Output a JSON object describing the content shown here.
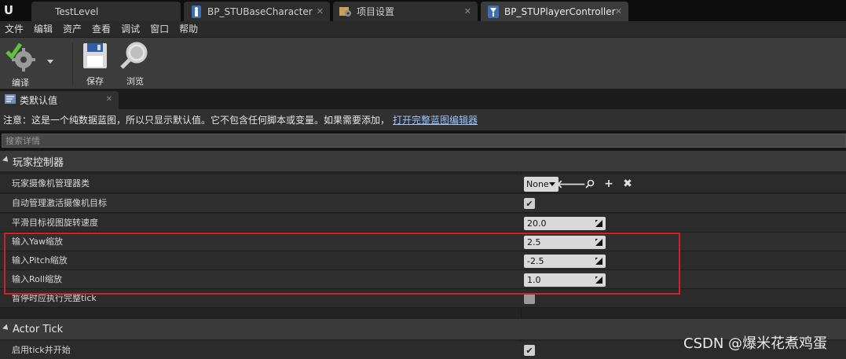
{
  "tabs": [
    {
      "label": "TestLevel",
      "icon": "level-icon"
    },
    {
      "label": "BP_STUBaseCharacter",
      "icon": "character-blueprint-icon"
    },
    {
      "label": "项目设置",
      "icon": "settings-icon"
    },
    {
      "label": "BP_STUPlayerController",
      "icon": "controller-blueprint-icon"
    }
  ],
  "menu": [
    "文件",
    "编辑",
    "资产",
    "查看",
    "调试",
    "窗口",
    "帮助"
  ],
  "toolbar": {
    "compile_label": "编译",
    "save_label": "保存",
    "browse_label": "浏览"
  },
  "panel": {
    "tab_label": "类默认值"
  },
  "notice": {
    "text": "注意：这是一个纯数据蓝图，所以只显示默认值。它不包含任何脚本或变量。如果需要添加，",
    "link": "打开完整蓝图编辑器"
  },
  "search": {
    "placeholder": "搜索详情"
  },
  "categories": {
    "player_controller": "玩家控制器",
    "actor_tick": "Actor Tick"
  },
  "properties": {
    "camera_manager_class": {
      "label": "玩家摄像机管理器类",
      "value": "None"
    },
    "auto_manage_camera": {
      "label": "自动管理激活摄像机目标",
      "checked": true
    },
    "smooth_rotation": {
      "label": "平滑目标视图旋转速度",
      "value": "20.0"
    },
    "input_yaw": {
      "label": "输入Yaw缩放",
      "value": "2.5"
    },
    "input_pitch": {
      "label": "输入Pitch缩放",
      "value": "-2.5"
    },
    "input_roll": {
      "label": "输入Roll缩放",
      "value": "1.0"
    },
    "tick_when_paused": {
      "label": "暂停时应执行完整tick",
      "checked": false
    },
    "start_with_tick": {
      "label": "启用tick并开始",
      "checked": true
    }
  },
  "watermark": "CSDN @爆米花煮鸡蛋",
  "colors": {
    "highlight_box": "#d2202b",
    "link": "#9cc3ff"
  }
}
